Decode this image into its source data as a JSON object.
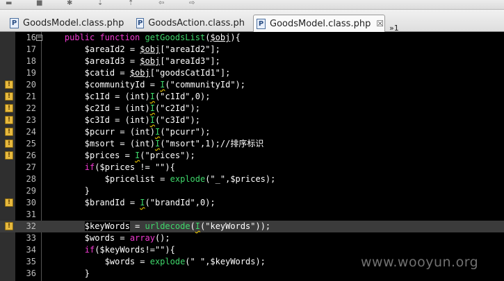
{
  "toolbar": {
    "buttons": [
      "save-icon",
      "stop-icon",
      "debug-icon",
      "next-annotation-icon",
      "prev-annotation-icon",
      "back-icon",
      "forward-icon"
    ]
  },
  "tabs": [
    {
      "label": "GoodsModel.class.php",
      "icon": "P",
      "active": false
    },
    {
      "label": "GoodsAction.class.ph",
      "icon": "P",
      "active": false
    },
    {
      "label": "GoodsModel.class.php",
      "icon": "P",
      "active": true,
      "close": "☒"
    }
  ],
  "overflow": {
    "label": "»1"
  },
  "lines": [
    {
      "n": "16",
      "marker": "",
      "fold": "−",
      "tokens": [
        [
          "    ",
          ""
        ],
        [
          "public function ",
          "kw"
        ],
        [
          "getGoodsList",
          "fn"
        ],
        [
          "(",
          "st"
        ],
        [
          "$obj",
          "vr ul"
        ],
        [
          "){",
          "st"
        ]
      ]
    },
    {
      "n": "17",
      "marker": "",
      "tokens": [
        [
          "        $areaId2 = ",
          ""
        ],
        [
          "$obj",
          "vr ul"
        ],
        [
          "[\"areaId2\"];",
          ""
        ]
      ]
    },
    {
      "n": "18",
      "marker": "",
      "tokens": [
        [
          "        $areaId3 = ",
          ""
        ],
        [
          "$obj",
          "vr ul"
        ],
        [
          "[\"areaId3\"];",
          ""
        ]
      ]
    },
    {
      "n": "19",
      "marker": "",
      "tokens": [
        [
          "        $catid = ",
          ""
        ],
        [
          "$obj",
          "vr ul"
        ],
        [
          "[\"goodsCatId1\"];",
          ""
        ]
      ]
    },
    {
      "n": "20",
      "marker": "warn",
      "tokens": [
        [
          "        $communityId = ",
          ""
        ],
        [
          "I",
          "fn sq"
        ],
        [
          "(\"communityId\");",
          ""
        ]
      ]
    },
    {
      "n": "21",
      "marker": "warn",
      "tokens": [
        [
          "        $c1Id = (int)",
          ""
        ],
        [
          "I",
          "fn sq"
        ],
        [
          "(\"c1Id\",0);",
          ""
        ]
      ]
    },
    {
      "n": "22",
      "marker": "warn",
      "tokens": [
        [
          "        $c2Id = (int)",
          ""
        ],
        [
          "I",
          "fn sq"
        ],
        [
          "(\"c2Id\");",
          ""
        ]
      ]
    },
    {
      "n": "23",
      "marker": "warn",
      "tokens": [
        [
          "        $c3Id = (int)",
          ""
        ],
        [
          "I",
          "fn sq"
        ],
        [
          "(\"c3Id\");",
          ""
        ]
      ]
    },
    {
      "n": "24",
      "marker": "warn",
      "tokens": [
        [
          "        $pcurr = (int)",
          ""
        ],
        [
          "I",
          "fn sq"
        ],
        [
          "(\"pcurr\");",
          ""
        ]
      ]
    },
    {
      "n": "25",
      "marker": "warn",
      "tokens": [
        [
          "        $msort = (int)",
          ""
        ],
        [
          "I",
          "fn sq"
        ],
        [
          "(\"msort\",1);//排序标识",
          ""
        ]
      ]
    },
    {
      "n": "26",
      "marker": "warn",
      "tokens": [
        [
          "        $prices = ",
          ""
        ],
        [
          "I",
          "fn sq"
        ],
        [
          "(\"prices\");",
          ""
        ]
      ]
    },
    {
      "n": "27",
      "marker": "",
      "tokens": [
        [
          "        ",
          ""
        ],
        [
          "if",
          "kw"
        ],
        [
          "($prices != \"\"){",
          ""
        ]
      ]
    },
    {
      "n": "28",
      "marker": "",
      "tokens": [
        [
          "            $pricelist = ",
          ""
        ],
        [
          "explode",
          "fn"
        ],
        [
          "(\"_\",$prices);",
          ""
        ]
      ]
    },
    {
      "n": "29",
      "marker": "",
      "tokens": [
        [
          "        }",
          ""
        ]
      ]
    },
    {
      "n": "30",
      "marker": "warn",
      "tokens": [
        [
          "        $brandId = ",
          ""
        ],
        [
          "I",
          "fn sq"
        ],
        [
          "(\"brandId\",0);",
          ""
        ]
      ]
    },
    {
      "n": "31",
      "marker": "",
      "tokens": [
        [
          "",
          ""
        ]
      ]
    },
    {
      "n": "32",
      "marker": "warn",
      "highlight": true,
      "tokens": [
        [
          "        ",
          ""
        ],
        [
          "$keyWords",
          "sel"
        ],
        [
          " = ",
          ""
        ],
        [
          "urldecode",
          "fn"
        ],
        [
          "(",
          ""
        ],
        [
          "I",
          "fn sq"
        ],
        [
          "(\"keyWords\"));",
          ""
        ]
      ]
    },
    {
      "n": "33",
      "marker": "",
      "tokens": [
        [
          "        $words = ",
          ""
        ],
        [
          "array",
          "kw"
        ],
        [
          "();",
          ""
        ]
      ]
    },
    {
      "n": "34",
      "marker": "",
      "tokens": [
        [
          "        ",
          ""
        ],
        [
          "if",
          "kw"
        ],
        [
          "(",
          ""
        ],
        [
          "$keyWords",
          "sel"
        ],
        [
          "!=\"\"){",
          ""
        ]
      ]
    },
    {
      "n": "35",
      "marker": "",
      "tokens": [
        [
          "            $words = ",
          ""
        ],
        [
          "explode",
          "fn"
        ],
        [
          "(\" \",",
          ""
        ],
        [
          "$keyWords",
          "sel"
        ],
        [
          ");",
          ""
        ]
      ]
    },
    {
      "n": "36",
      "marker": "",
      "tokens": [
        [
          "        }",
          ""
        ]
      ]
    }
  ],
  "watermark": "www.wooyun.org"
}
